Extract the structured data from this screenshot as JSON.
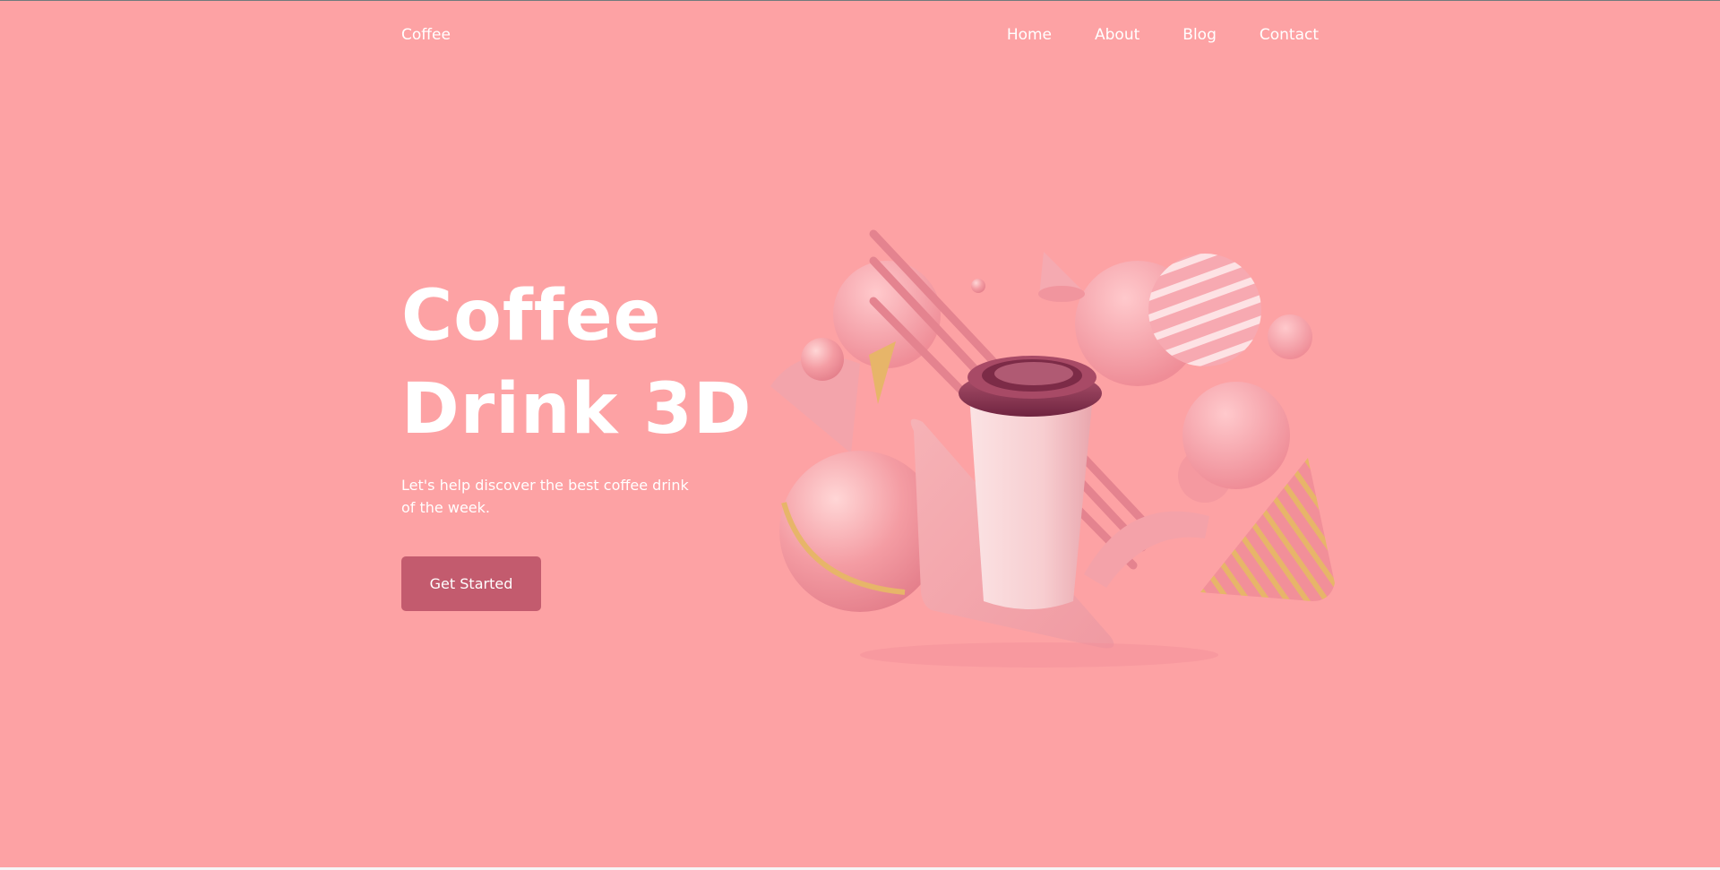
{
  "nav": {
    "logo": "Coffee",
    "links": [
      "Home",
      "About",
      "Blog",
      "Contact"
    ]
  },
  "hero": {
    "title_line1": "Coffee",
    "title_line2": "Drink 3D",
    "subtitle": "Let's help discover the best coffee drink of the week.",
    "cta_label": "Get Started"
  },
  "colors": {
    "background": "#fda2a4",
    "button": "#c35b6e",
    "text": "#ffffff",
    "accent_gold": "#e7b569",
    "cup_lid": "#8a3550"
  },
  "icons": [
    "coffee-cup-illustration"
  ]
}
